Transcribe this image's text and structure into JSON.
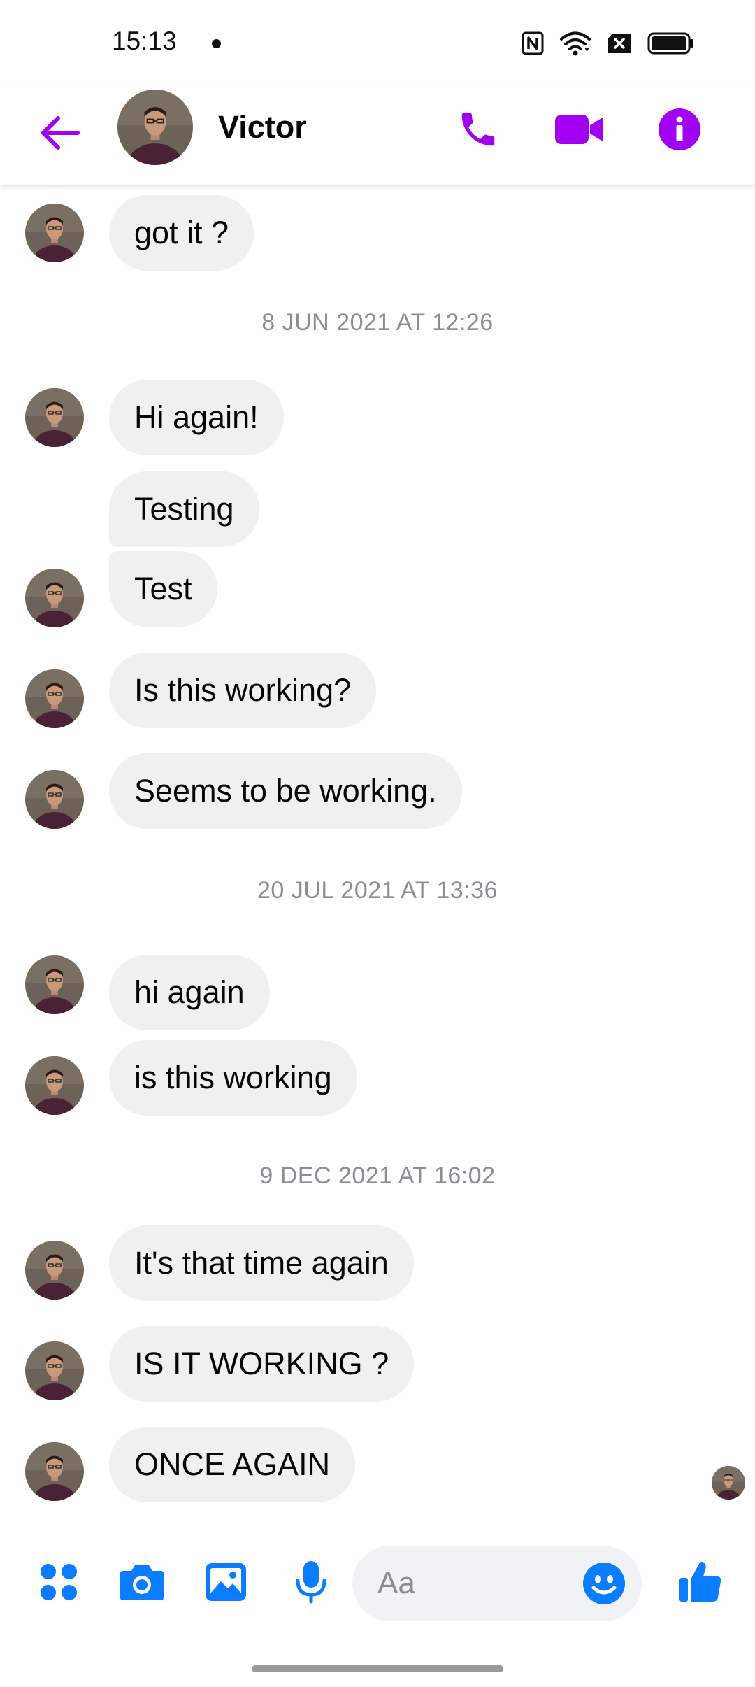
{
  "status_bar": {
    "time": "15:13",
    "icons": [
      "nfc-icon",
      "wifi-icon",
      "no-sim-icon",
      "battery-icon"
    ]
  },
  "header": {
    "contact_name": "Victor",
    "accent_color": "#a100f2",
    "actions": [
      "phone-icon",
      "video-camera-icon",
      "info-icon"
    ]
  },
  "conversation": {
    "messages_top": {
      "text": "got it ?"
    },
    "timestamps": [
      "8 JUN 2021 AT 12:26",
      "20 JUL 2021 AT 13:36",
      "9 DEC 2021 AT 16:02"
    ],
    "messages": [
      "Hi again!",
      "Testing",
      "Test",
      "Is this working?",
      "Seems to be working.",
      "hi again",
      "is this working",
      "It's that time again",
      "IS IT WORKING ?",
      "ONCE AGAIN"
    ],
    "bubble_color": "#f0f0f0"
  },
  "composer": {
    "placeholder": "Aa",
    "accent_color": "#0a7cff",
    "buttons": [
      "grid-menu-icon",
      "camera-icon",
      "gallery-icon",
      "microphone-icon",
      "emoji-icon",
      "thumbs-up-icon"
    ]
  }
}
